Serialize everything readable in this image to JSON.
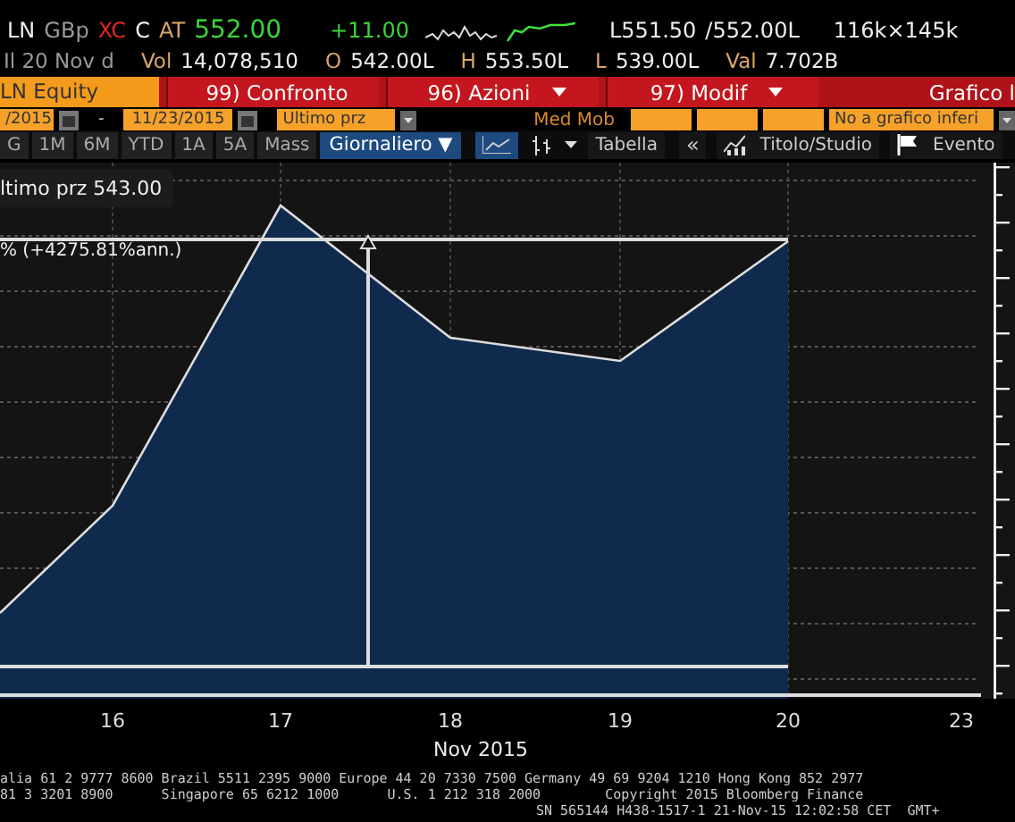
{
  "quote": {
    "ticker": "LN",
    "currency": "GBp",
    "exchange": "XC",
    "condition": "C",
    "at": "AT",
    "last": "552.00",
    "change": "+11.00",
    "bid": "L551.50",
    "ask": "/552.00L",
    "size": "116k×145k"
  },
  "session": {
    "date": "Il 20 Nov d",
    "stats": [
      {
        "label": "Vol",
        "value": "14,078,510"
      },
      {
        "label": "O",
        "value": "542.00L"
      },
      {
        "label": "H",
        "value": "553.50L"
      },
      {
        "label": "L",
        "value": "539.00L"
      },
      {
        "label": "Val",
        "value": "7.702B"
      }
    ]
  },
  "toolbar": {
    "security": "LN Equity",
    "buttons": [
      {
        "label": "99) Confronto",
        "dropdown": false
      },
      {
        "label": "96) Azioni",
        "dropdown": true
      },
      {
        "label": "97) Modif",
        "dropdown": true
      }
    ],
    "title": "Grafico l"
  },
  "fields": {
    "start_date": "/2015",
    "separator": "-",
    "end_date": "11/23/2015",
    "price_field": "Ultimo prz",
    "moving_average": "Med Mob",
    "lower_chart": "No a grafico inferi"
  },
  "ranges": [
    {
      "label": "G",
      "selected": false
    },
    {
      "label": "1M",
      "selected": false
    },
    {
      "label": "6M",
      "selected": false
    },
    {
      "label": "YTD",
      "selected": false
    },
    {
      "label": "1A",
      "selected": false
    },
    {
      "label": "5A",
      "selected": false
    },
    {
      "label": "Mass",
      "selected": false
    }
  ],
  "frequency": "Giornaliero ▼",
  "tools": [
    {
      "kind": "table",
      "label": "Tabella"
    },
    {
      "kind": "collapse",
      "label": "«"
    },
    {
      "kind": "study",
      "label": "Titolo/Studio"
    },
    {
      "kind": "event",
      "label": "Evento"
    }
  ],
  "chart": {
    "legend": "ltimo prz 543.00",
    "annotation": "% (+4275.81%ann.)",
    "x_labels": [
      "16",
      "17",
      "18",
      "19",
      "20",
      "23"
    ],
    "period": "Nov 2015"
  },
  "footer": [
    "alia 61 2 9777 8600 Brazil 5511 2395 9000 Europe 44 20 7330 7500 Germany 49 69 9204 1210 Hong Kong 852 2977",
    "81 3 3201 8900      Singapore 65 6212 1000      U.S. 1 212 318 2000        Copyright 2015 Bloomberg Finance",
    "SN 565144 H438-1517-1 21-Nov-15 12:02:58 CET  GMT+"
  ]
}
